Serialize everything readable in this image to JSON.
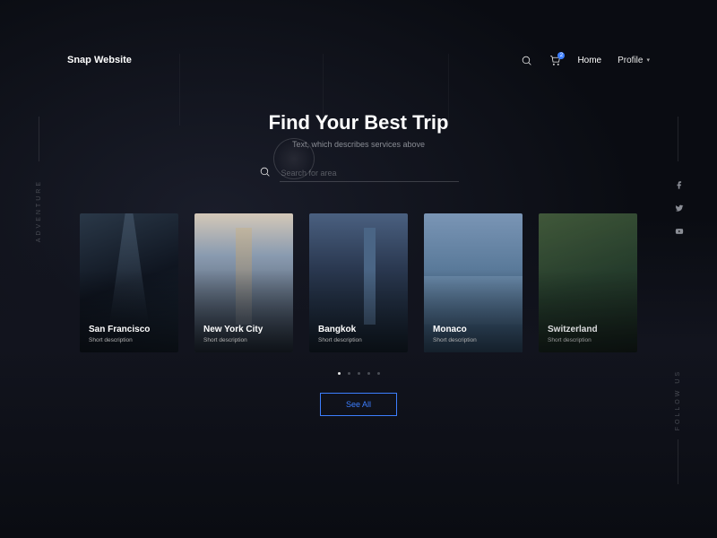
{
  "brand": "Snap Website",
  "nav": {
    "cart_badge": "2",
    "home": "Home",
    "profile": "Profile"
  },
  "hero": {
    "title": "Find Your Best Trip",
    "subtitle": "Text, which describes services above"
  },
  "search": {
    "placeholder": "Search for area"
  },
  "cards": [
    {
      "title": "San Francisco",
      "desc": "Short description"
    },
    {
      "title": "New York City",
      "desc": "Short description"
    },
    {
      "title": "Bangkok",
      "desc": "Short description"
    },
    {
      "title": "Monaco",
      "desc": "Short description"
    },
    {
      "title": "Switzerland",
      "desc": "Short description"
    }
  ],
  "cta": {
    "see_all": "See All"
  },
  "side": {
    "left": "ADVENTURE",
    "right": "FOLLOW US"
  },
  "colors": {
    "accent": "#3d7fff",
    "bg": "#0a0c12"
  }
}
